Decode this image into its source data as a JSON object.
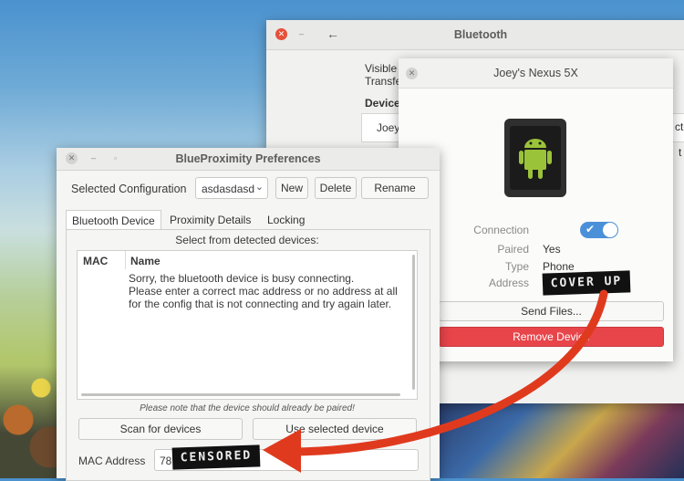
{
  "bluetooth_window": {
    "title": "Bluetooth",
    "visible_line1": "Visible",
    "visible_line2": "Transfe",
    "devices_heading": "Device",
    "device_row1": "Joey",
    "right_frag1": "cto",
    "right_frag2": "t U"
  },
  "nexus_dialog": {
    "title": "Joey's Nexus 5X",
    "connection_label": "Connection",
    "connection_on": true,
    "paired_label": "Paired",
    "paired_value": "Yes",
    "type_label": "Type",
    "type_value": "Phone",
    "address_label": "Address",
    "address_censor": "COVER UP",
    "send_files_label": "Send Files...",
    "remove_device_label": "Remove Device",
    "remove_color": "#e8454b",
    "toggle_color": "#4a90d9"
  },
  "bp_window": {
    "title": "BlueProximity Preferences",
    "config_label": "Selected Configuration",
    "config_value": "asdasdasd",
    "new_label": "New",
    "delete_label": "Delete",
    "rename_label": "Rename",
    "tabs": [
      "Bluetooth Device",
      "Proximity Details",
      "Locking"
    ],
    "select_prompt": "Select from detected devices:",
    "col_mac": "MAC",
    "col_name": "Name",
    "message_line1": "Sorry, the bluetooth device is busy connecting.",
    "message_line2": "Please enter a correct mac address or no address at all",
    "message_line3": "for the config that is not connecting and try again later.",
    "note": "Please note that the device should already be paired!",
    "scan_label": "Scan for devices",
    "use_label": "Use selected device",
    "mac_label": "MAC Address",
    "mac_prefix": "78",
    "mac_censor": "CENSORED"
  },
  "annotation": {
    "arrow_color": "#e03a1e"
  }
}
